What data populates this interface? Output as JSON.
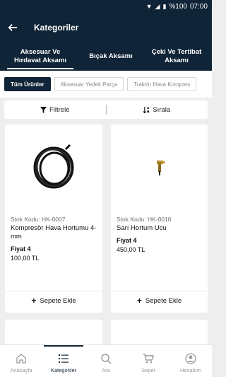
{
  "status": {
    "battery": "%100",
    "time": "07:00"
  },
  "appbar": {
    "title": "Kategoriler"
  },
  "category_tabs": [
    {
      "label": "Aksesuar Ve\nHırdavat Aksamı",
      "active": true
    },
    {
      "label": "Bıçak Aksamı",
      "active": false
    },
    {
      "label": "Çeki Ve Tertibat\nAksamı",
      "active": false
    }
  ],
  "chips": [
    {
      "label": "Tüm Ürünler",
      "active": true
    },
    {
      "label": "Aksesuar Yedek Parça",
      "active": false
    },
    {
      "label": "Traktör Hava Kompres",
      "active": false
    }
  ],
  "filter": {
    "filter_label": "Filtrele",
    "sort_label": "Sırala"
  },
  "products": [
    {
      "code": "Stok Kodu: HK-0007",
      "name": "Kompresör Hava Hortumu 4-mm",
      "price_label": "Fiyat 4",
      "price": "100,00 TL",
      "add_label": "Sepete Ekle"
    },
    {
      "code": "Stok Kodu: HK-0010",
      "name": "Sarı Hortum Ucu",
      "price_label": "Fiyat 4",
      "price": "450,00 TL",
      "add_label": "Sepete Ekle"
    }
  ],
  "bottom_nav": [
    {
      "label": "Anasayfa",
      "icon": "home-icon",
      "active": false
    },
    {
      "label": "Kategoriler",
      "icon": "list-icon",
      "active": true
    },
    {
      "label": "Ara",
      "icon": "search-icon",
      "active": false
    },
    {
      "label": "Sepet",
      "icon": "cart-icon",
      "active": false
    },
    {
      "label": "Hesabım",
      "icon": "account-icon",
      "active": false
    }
  ],
  "colors": {
    "primary": "#0f2436",
    "background": "#eeeeee"
  }
}
